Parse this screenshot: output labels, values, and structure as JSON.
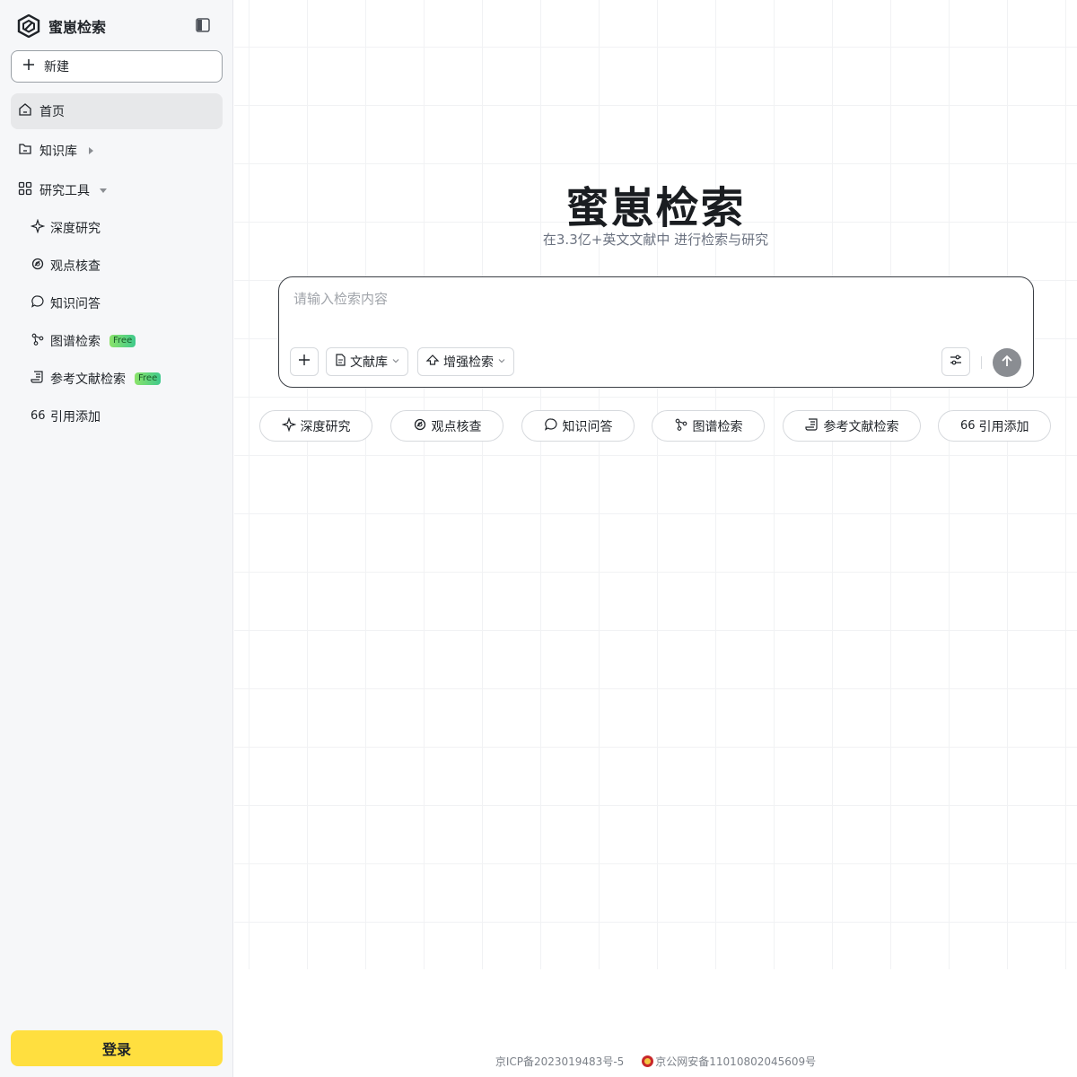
{
  "brand": {
    "name": "蜜崽检索"
  },
  "sidebar": {
    "new_label": "新建",
    "nav": [
      {
        "label": "首页",
        "icon": "home-icon"
      },
      {
        "label": "知识库",
        "icon": "folder-icon"
      },
      {
        "label": "研究工具",
        "icon": "grid-icon"
      }
    ],
    "tools": [
      {
        "label": "深度研究",
        "icon": "sparkle-icon",
        "badge": ""
      },
      {
        "label": "观点核查",
        "icon": "check-circle-icon",
        "badge": ""
      },
      {
        "label": "知识问答",
        "icon": "chat-bubble-icon",
        "badge": ""
      },
      {
        "label": "图谱检索",
        "icon": "graph-icon",
        "badge": "Free"
      },
      {
        "label": "参考文献检索",
        "icon": "scroll-icon",
        "badge": "Free"
      },
      {
        "label": "引用添加",
        "icon": "quote-icon",
        "badge": ""
      }
    ],
    "login_label": "登录"
  },
  "main": {
    "title": "蜜崽检索",
    "subtitle": "在3.3亿+英文文献中 进行检索与研究",
    "search": {
      "placeholder": "请输入检索内容",
      "library_label": "文献库",
      "enhance_label": "增强检索"
    },
    "chips": [
      {
        "label": "深度研究",
        "icon": "sparkle-icon"
      },
      {
        "label": "观点核查",
        "icon": "check-circle-icon"
      },
      {
        "label": "知识问答",
        "icon": "chat-bubble-icon"
      },
      {
        "label": "图谱检索",
        "icon": "graph-icon"
      },
      {
        "label": "参考文献检索",
        "icon": "scroll-icon"
      },
      {
        "label": "引用添加",
        "icon": "quote-icon"
      }
    ]
  },
  "footer": {
    "icp": "京ICP备2023019483号-5",
    "police": "京公网安备11010802045609号"
  },
  "colors": {
    "accent": "#ffdf3f",
    "badge": "#6cd87a",
    "send": "#8a8d92"
  }
}
